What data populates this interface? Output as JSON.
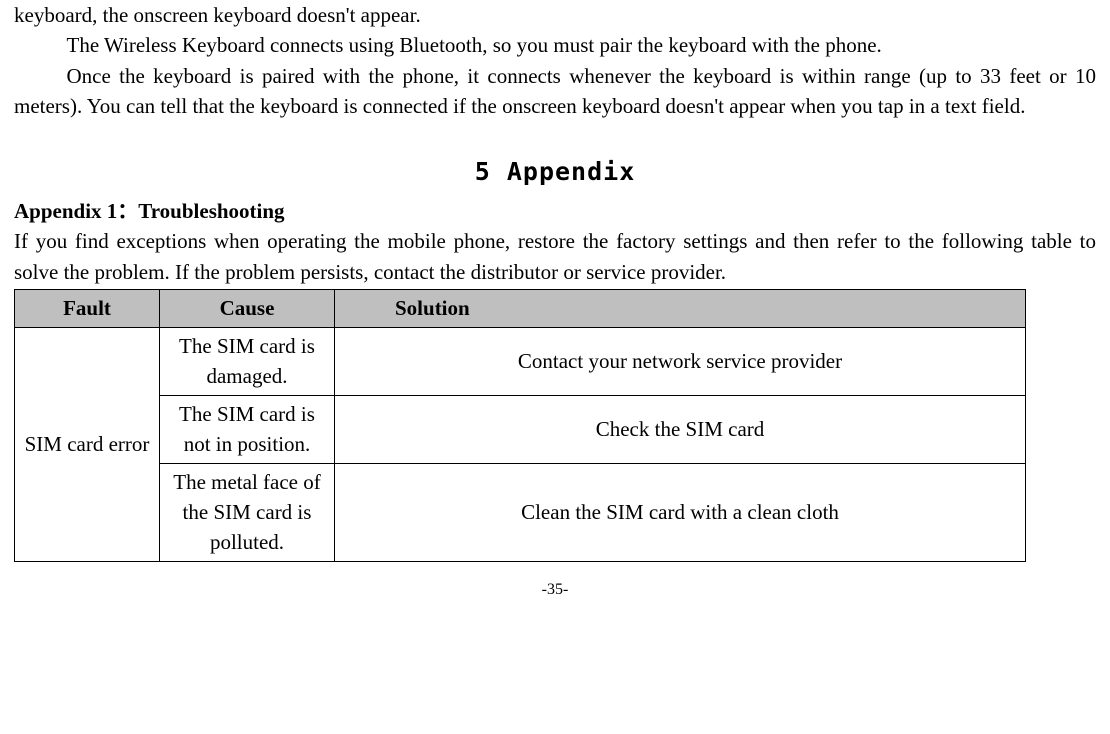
{
  "paragraphs": {
    "p0": "keyboard, the onscreen keyboard doesn't appear.",
    "p1": "The Wireless Keyboard connects using Bluetooth, so you must pair the keyboard with the phone.",
    "p2": "Once the keyboard is paired with the phone, it connects whenever the keyboard is within range (up to 33 feet or 10 meters). You can tell that the keyboard is connected if the onscreen keyboard doesn't appear when you tap in a text field."
  },
  "section_title": "5 Appendix",
  "appendix_heading": "Appendix 1：Troubleshooting",
  "appendix_intro": "If you find exceptions when operating the mobile phone, restore the factory settings and then refer to the following table to solve the problem. If the problem persists, contact the distributor or service provider.",
  "table": {
    "headers": {
      "fault": "Fault",
      "cause": "Cause",
      "solution": "Solution"
    },
    "fault": "SIM card error",
    "rows": [
      {
        "cause": "The SIM card is damaged.",
        "solution": "Contact your network service provider"
      },
      {
        "cause": "The SIM card is not in position.",
        "solution": "Check the SIM card"
      },
      {
        "cause": "The metal face of the SIM card is polluted.",
        "solution": "Clean the SIM card with a clean cloth"
      }
    ]
  },
  "page_number": "-35-"
}
